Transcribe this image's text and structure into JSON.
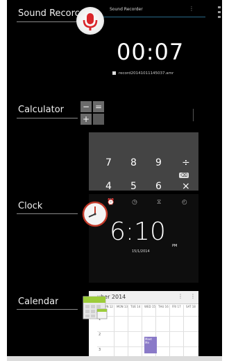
{
  "recents": {
    "items": [
      {
        "label": "Sound Recorc",
        "icon": "microphone-icon"
      },
      {
        "label": "Calculator",
        "icon": "calculator-icon"
      },
      {
        "label": "Clock",
        "icon": "clock-icon"
      },
      {
        "label": "Calendar",
        "icon": "calendar-icon"
      }
    ]
  },
  "sound_recorder": {
    "title": "Sound Recorder",
    "menu": "⋮",
    "time": "00:07",
    "file": "record20141011145037.amr"
  },
  "calculator": {
    "rows": [
      [
        "7",
        "8",
        "9",
        "÷"
      ],
      [
        "4",
        "5",
        "6",
        "×"
      ]
    ],
    "delete": "⌫"
  },
  "clock": {
    "tabs": [
      "⏰",
      "◷",
      "⧖",
      "◴"
    ],
    "time": "6:10",
    "ampm": "PM",
    "date": "15/1/2014"
  },
  "calendar": {
    "month": "uber 2014",
    "header_icons": [
      "⋮",
      "⋮"
    ],
    "days": [
      "SUN 12",
      "MON 13",
      "TUE 14",
      "WED 15",
      "THU 16",
      "FRI 17",
      "SAT 18"
    ],
    "hours": [
      "1",
      "2",
      "3"
    ],
    "event_label": "Meet Me"
  },
  "colors": {
    "mic_red": "#d9262b",
    "accent_blue": "#2a6a8a",
    "event_purple": "#8a7ac8"
  }
}
